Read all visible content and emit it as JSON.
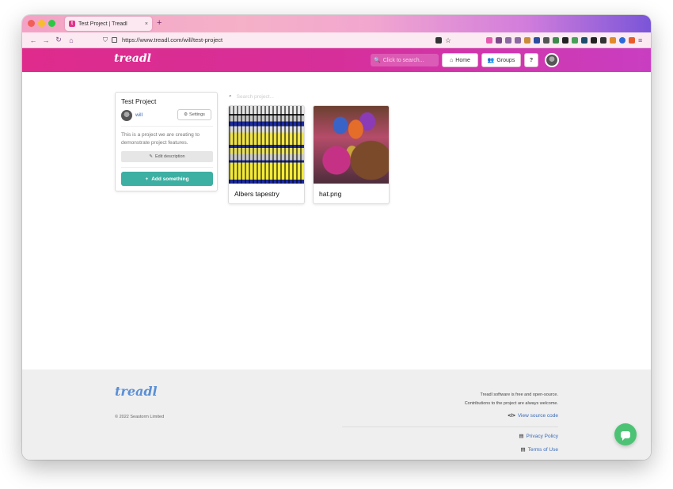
{
  "browser": {
    "tab_title": "Test Project | Treadl",
    "tab_close": "×",
    "new_tab": "+",
    "url": "https://www.treadl.com/will/test-project"
  },
  "header": {
    "logo": "treadl",
    "search_placeholder": "Click to search...",
    "home_label": "Home",
    "groups_label": "Groups",
    "help_label": "?"
  },
  "project": {
    "name": "Test Project",
    "owner": "will",
    "settings_label": "Settings",
    "description": "This is a project we are creating to demonstrate project features.",
    "edit_description_label": "Edit description",
    "add_something_label": "Add something",
    "search_placeholder": "Search project..."
  },
  "objects": [
    {
      "name": "Albers tapestry"
    },
    {
      "name": "hat.png"
    }
  ],
  "footer": {
    "logo": "treadl",
    "copyright": "© 2022 Seastorm Limited",
    "open_source_line1": "Treadl software is free and open-source.",
    "open_source_line2": "Contributions to the project are always welcome.",
    "view_source": "View source code",
    "privacy": "Privacy Policy",
    "terms": "Terms of Use"
  },
  "colors": {
    "brand": "#de2b8c",
    "accent": "#3dafa3",
    "link": "#3a6ab7",
    "chat": "#4cc374"
  }
}
